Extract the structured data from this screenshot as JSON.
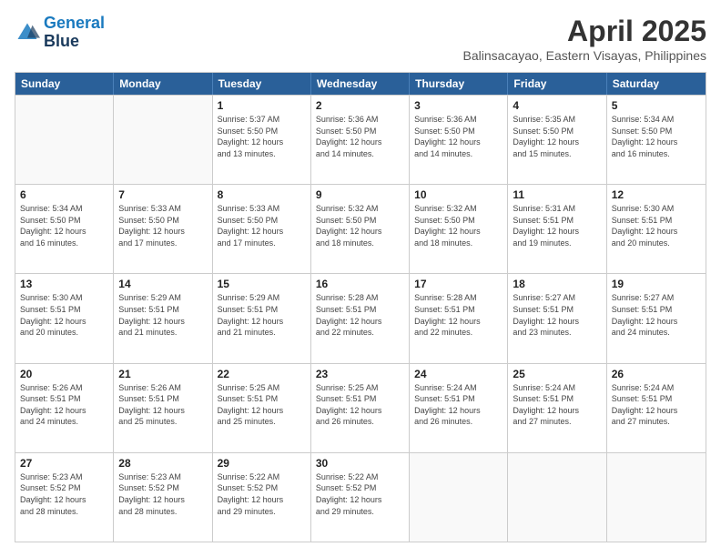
{
  "logo": {
    "line1": "General",
    "line2": "Blue"
  },
  "title": "April 2025",
  "subtitle": "Balinsacayao, Eastern Visayas, Philippines",
  "header_days": [
    "Sunday",
    "Monday",
    "Tuesday",
    "Wednesday",
    "Thursday",
    "Friday",
    "Saturday"
  ],
  "weeks": [
    [
      {
        "day": "",
        "info": ""
      },
      {
        "day": "",
        "info": ""
      },
      {
        "day": "1",
        "info": "Sunrise: 5:37 AM\nSunset: 5:50 PM\nDaylight: 12 hours\nand 13 minutes."
      },
      {
        "day": "2",
        "info": "Sunrise: 5:36 AM\nSunset: 5:50 PM\nDaylight: 12 hours\nand 14 minutes."
      },
      {
        "day": "3",
        "info": "Sunrise: 5:36 AM\nSunset: 5:50 PM\nDaylight: 12 hours\nand 14 minutes."
      },
      {
        "day": "4",
        "info": "Sunrise: 5:35 AM\nSunset: 5:50 PM\nDaylight: 12 hours\nand 15 minutes."
      },
      {
        "day": "5",
        "info": "Sunrise: 5:34 AM\nSunset: 5:50 PM\nDaylight: 12 hours\nand 16 minutes."
      }
    ],
    [
      {
        "day": "6",
        "info": "Sunrise: 5:34 AM\nSunset: 5:50 PM\nDaylight: 12 hours\nand 16 minutes."
      },
      {
        "day": "7",
        "info": "Sunrise: 5:33 AM\nSunset: 5:50 PM\nDaylight: 12 hours\nand 17 minutes."
      },
      {
        "day": "8",
        "info": "Sunrise: 5:33 AM\nSunset: 5:50 PM\nDaylight: 12 hours\nand 17 minutes."
      },
      {
        "day": "9",
        "info": "Sunrise: 5:32 AM\nSunset: 5:50 PM\nDaylight: 12 hours\nand 18 minutes."
      },
      {
        "day": "10",
        "info": "Sunrise: 5:32 AM\nSunset: 5:50 PM\nDaylight: 12 hours\nand 18 minutes."
      },
      {
        "day": "11",
        "info": "Sunrise: 5:31 AM\nSunset: 5:51 PM\nDaylight: 12 hours\nand 19 minutes."
      },
      {
        "day": "12",
        "info": "Sunrise: 5:30 AM\nSunset: 5:51 PM\nDaylight: 12 hours\nand 20 minutes."
      }
    ],
    [
      {
        "day": "13",
        "info": "Sunrise: 5:30 AM\nSunset: 5:51 PM\nDaylight: 12 hours\nand 20 minutes."
      },
      {
        "day": "14",
        "info": "Sunrise: 5:29 AM\nSunset: 5:51 PM\nDaylight: 12 hours\nand 21 minutes."
      },
      {
        "day": "15",
        "info": "Sunrise: 5:29 AM\nSunset: 5:51 PM\nDaylight: 12 hours\nand 21 minutes."
      },
      {
        "day": "16",
        "info": "Sunrise: 5:28 AM\nSunset: 5:51 PM\nDaylight: 12 hours\nand 22 minutes."
      },
      {
        "day": "17",
        "info": "Sunrise: 5:28 AM\nSunset: 5:51 PM\nDaylight: 12 hours\nand 22 minutes."
      },
      {
        "day": "18",
        "info": "Sunrise: 5:27 AM\nSunset: 5:51 PM\nDaylight: 12 hours\nand 23 minutes."
      },
      {
        "day": "19",
        "info": "Sunrise: 5:27 AM\nSunset: 5:51 PM\nDaylight: 12 hours\nand 24 minutes."
      }
    ],
    [
      {
        "day": "20",
        "info": "Sunrise: 5:26 AM\nSunset: 5:51 PM\nDaylight: 12 hours\nand 24 minutes."
      },
      {
        "day": "21",
        "info": "Sunrise: 5:26 AM\nSunset: 5:51 PM\nDaylight: 12 hours\nand 25 minutes."
      },
      {
        "day": "22",
        "info": "Sunrise: 5:25 AM\nSunset: 5:51 PM\nDaylight: 12 hours\nand 25 minutes."
      },
      {
        "day": "23",
        "info": "Sunrise: 5:25 AM\nSunset: 5:51 PM\nDaylight: 12 hours\nand 26 minutes."
      },
      {
        "day": "24",
        "info": "Sunrise: 5:24 AM\nSunset: 5:51 PM\nDaylight: 12 hours\nand 26 minutes."
      },
      {
        "day": "25",
        "info": "Sunrise: 5:24 AM\nSunset: 5:51 PM\nDaylight: 12 hours\nand 27 minutes."
      },
      {
        "day": "26",
        "info": "Sunrise: 5:24 AM\nSunset: 5:51 PM\nDaylight: 12 hours\nand 27 minutes."
      }
    ],
    [
      {
        "day": "27",
        "info": "Sunrise: 5:23 AM\nSunset: 5:52 PM\nDaylight: 12 hours\nand 28 minutes."
      },
      {
        "day": "28",
        "info": "Sunrise: 5:23 AM\nSunset: 5:52 PM\nDaylight: 12 hours\nand 28 minutes."
      },
      {
        "day": "29",
        "info": "Sunrise: 5:22 AM\nSunset: 5:52 PM\nDaylight: 12 hours\nand 29 minutes."
      },
      {
        "day": "30",
        "info": "Sunrise: 5:22 AM\nSunset: 5:52 PM\nDaylight: 12 hours\nand 29 minutes."
      },
      {
        "day": "",
        "info": ""
      },
      {
        "day": "",
        "info": ""
      },
      {
        "day": "",
        "info": ""
      }
    ]
  ]
}
